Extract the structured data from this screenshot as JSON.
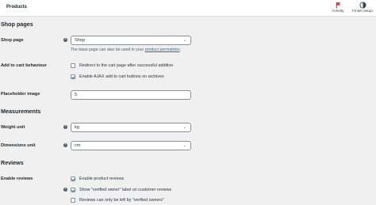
{
  "topbar": {
    "title": "Products",
    "activity_label": "Activity",
    "finish_setup_label": "Finish setup"
  },
  "sections": {
    "shop_pages": "Shop pages",
    "measurements": "Measurements",
    "reviews": "Reviews"
  },
  "shop_page": {
    "label": "Shop page",
    "value": "Shop",
    "description_prefix": "The base page can also be used in your",
    "description_link": "product permalinks",
    "description_suffix": "."
  },
  "add_to_cart": {
    "label": "Add to cart behaviour",
    "options": [
      {
        "text": "Redirect to the cart page after successful addition",
        "checked": false
      },
      {
        "text": "Enable AJAX add to cart buttons on archives",
        "checked": true
      }
    ]
  },
  "placeholder_image": {
    "label": "Placeholder image",
    "value": "5"
  },
  "weight_unit": {
    "label": "Weight unit",
    "value": "kg"
  },
  "dimensions_unit": {
    "label": "Dimensions unit",
    "value": "cm"
  },
  "enable_reviews": {
    "label": "Enable reviews",
    "options": [
      {
        "text": "Enable product reviews",
        "checked": true
      },
      {
        "text": "Show \"verified owner\" label on customer reviews",
        "checked": true
      },
      {
        "text": "Reviews can only be left by \"verified owners\"",
        "checked": false
      }
    ]
  },
  "help_glyph": "?",
  "dropdown_glyph": "⌄",
  "colors": {
    "accent": "#2271b1",
    "background": "#f0f0f1",
    "activity_flag": "#d63638"
  }
}
